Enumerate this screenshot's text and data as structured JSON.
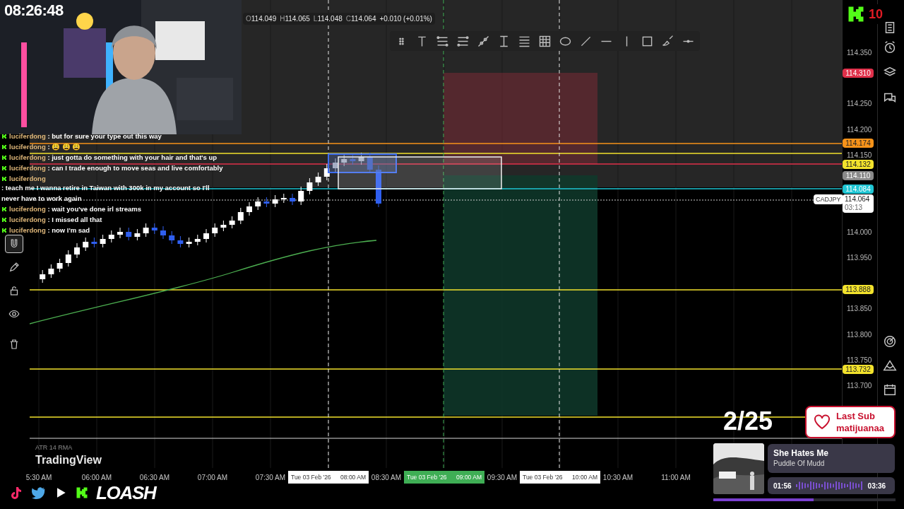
{
  "clock": "08:26:48",
  "ohlc": {
    "parts": [
      {
        "label": "O",
        "value": "114.049"
      },
      {
        "label": "H",
        "value": "114.065"
      },
      {
        "label": "L",
        "value": "114.048"
      },
      {
        "label": "C",
        "value": "114.064"
      }
    ],
    "change": "+0.010 (+0.01%)"
  },
  "chat": [
    {
      "user": "luciferdong",
      "text": ": but for sure your type out this way"
    },
    {
      "user": "luciferdong",
      "text": ": 😩 😩 😩"
    },
    {
      "user": "luciferdong",
      "text": ": just gotta do something with your hair and that's up"
    },
    {
      "user": "luciferdong",
      "text": ": can I trade enough to move seas and live comfortably"
    },
    {
      "user": "luciferdong",
      "text": ": teach me I wanna retire in Taiwan with 300k in my account so I'll",
      "continuation": "never have to work again"
    },
    {
      "user": "luciferdong",
      "text": ": wait you've done irl streams"
    },
    {
      "user": "luciferdong",
      "text": ": I missed all that"
    },
    {
      "user": "luciferdong",
      "text": ": now I'm sad"
    }
  ],
  "left_toolbar": [
    {
      "kind": "magnet",
      "selected": true
    },
    {
      "kind": "pencil",
      "selected": false
    },
    {
      "kind": "lock",
      "selected": false
    },
    {
      "kind": "eye",
      "selected": false
    },
    {
      "kind": "trash",
      "selected": false
    }
  ],
  "price_axis": {
    "ticks": [
      "114.350",
      "114.250",
      "114.200",
      "114.150",
      "114.000",
      "113.950",
      "113.850",
      "113.800",
      "113.750",
      "113.700"
    ],
    "labels": [
      {
        "value": "114.310",
        "color": "#e0304a"
      },
      {
        "value": "114.174",
        "color": "#f7931a"
      },
      {
        "value": "114.132",
        "color": "#f2e22c"
      },
      {
        "value": "114.110",
        "color": "#8a8a8a"
      },
      {
        "value": "114.084",
        "color": "#1fc6d4"
      },
      {
        "value": "113.888",
        "color": "#f2e22c"
      },
      {
        "value": "113.732",
        "color": "#f2e22c"
      }
    ],
    "current": {
      "symbol": "CADJPY",
      "price": "114.064",
      "countdown": "03:13"
    }
  },
  "time_axis": [
    {
      "kind": "tick",
      "text": "5:30 AM"
    },
    {
      "kind": "tick",
      "text": "06:00 AM"
    },
    {
      "kind": "tick",
      "text": "06:30 AM"
    },
    {
      "kind": "tick",
      "text": "07:00 AM"
    },
    {
      "kind": "tick",
      "text": "07:30 AM"
    },
    {
      "kind": "crosshair",
      "date": "Tue 03 Feb '26",
      "text": "08:00 AM"
    },
    {
      "kind": "tick",
      "text": "08:30 AM"
    },
    {
      "kind": "position",
      "date": "Tue 03 Feb '26",
      "text": "09:00 AM"
    },
    {
      "kind": "tick",
      "text": "09:30 AM"
    },
    {
      "kind": "crosshair",
      "date": "Tue 03 Feb '26",
      "text": "10:00 AM"
    },
    {
      "kind": "tick",
      "text": "10:30 AM"
    },
    {
      "kind": "tick",
      "text": "11:00 AM"
    }
  ],
  "indicator": "ATR 14 RMA",
  "brand": "TradingView",
  "kick_badge": "10",
  "counter": "2/25",
  "last_sub": {
    "title": "Last Sub",
    "name": "matijuanaa"
  },
  "now_playing": {
    "title": "She Hates Me",
    "artist": "Puddle Of Mudd",
    "elapsed": "01:56",
    "total": "03:36",
    "level": 0.55
  },
  "socials": {
    "channel": "LOASH"
  }
}
